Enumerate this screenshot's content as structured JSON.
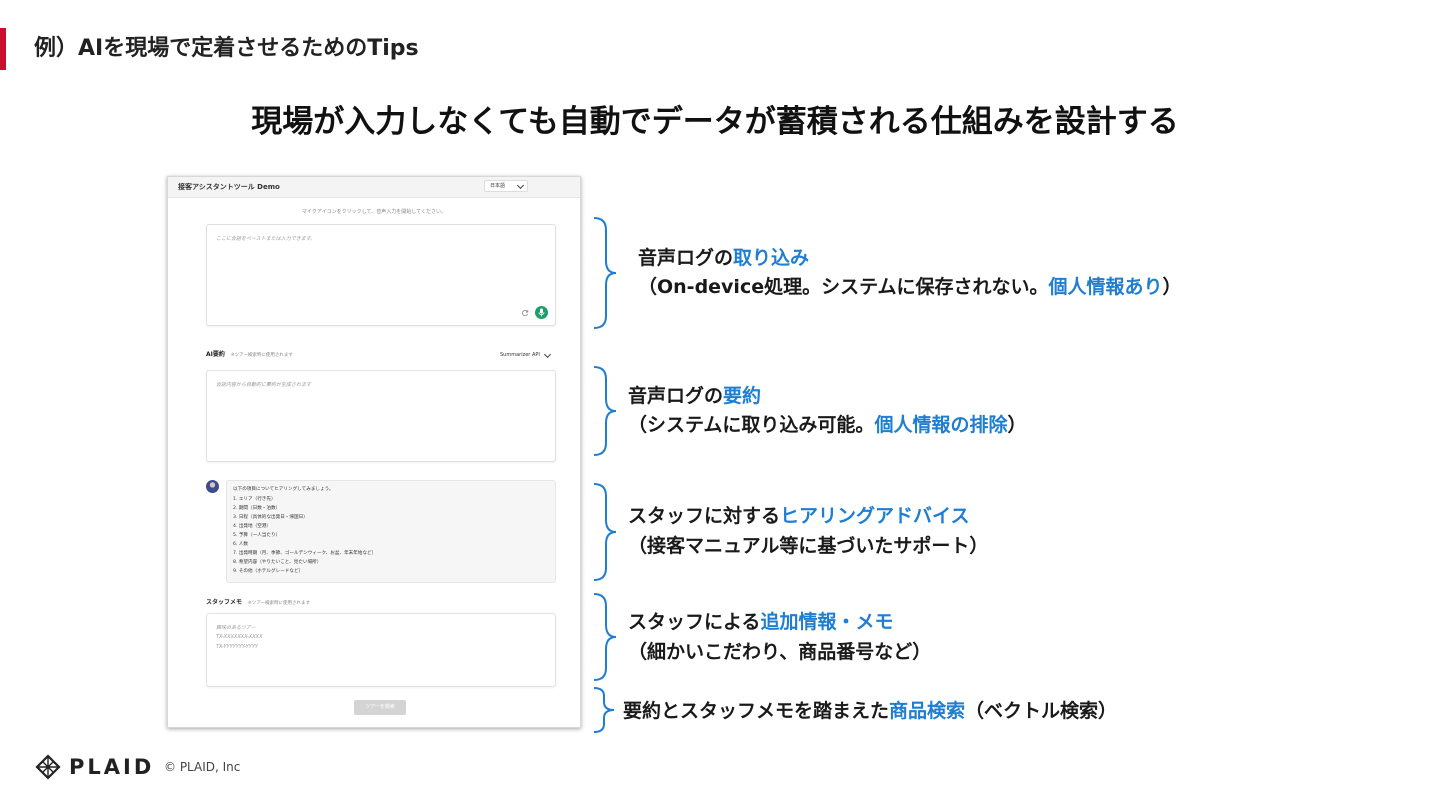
{
  "theme": {
    "accent": "#c8102e",
    "highlight": "#1f7ed1",
    "mic_green": "#1f9d6b"
  },
  "slide": {
    "label": "例）AIを現場で定着させるためのTips",
    "headline": "現場が入力しなくても自動でデータが蓄積される仕組みを設計する"
  },
  "app": {
    "title": "接客アシスタントツール Demo",
    "language": "日本語",
    "mic_hint": "マイクアイコンをクリックして、音声入力を開始してください。",
    "input_placeholder": "ここに会話をペーストまたは入力できます。",
    "refresh_icon": "refresh-icon",
    "mic_icon": "mic-icon",
    "summary": {
      "label": "AI要約",
      "note": "※ツアー検索時に使用されます",
      "api": "Summarizer API",
      "placeholder": "会話内容から自動的に要約が生成されます"
    },
    "chat": {
      "intro": "以下の項目についてヒアリングしてみましょう。",
      "items": [
        "1. エリア（行き先）",
        "2. 期間（日数・泊数）",
        "3. 日程（具体的な出発日・帰国日）",
        "4. 出発地（空港）",
        "5. 予算（一人当たり）",
        "6. 人数",
        "7. 出発時期（月、季節、ゴールデンウィーク、お盆、年末年始など）",
        "8. 希望内容（やりたいこと、見たい場所）",
        "9. その他（ホテルグレードなど）"
      ]
    },
    "memo": {
      "label": "スタッフメモ",
      "note": "※ツアー検索時に使用されます",
      "lines": [
        "興味のあるツアー",
        "TX-XXXXXXX-XXXX",
        "TX-YYYYYYY-YYYY"
      ]
    },
    "search_button": "ツアーを検索"
  },
  "annotations": [
    {
      "line1_pre": "音声ログの",
      "line1_hl": "取り込み",
      "line2_pre": "（On-device処理。システムに保存されない。",
      "line2_hl": "個人情報あり",
      "line2_post": "）"
    },
    {
      "line1_pre": "音声ログの",
      "line1_hl": "要約",
      "line2_pre": "（システムに取り込み可能。",
      "line2_hl": "個人情報の排除",
      "line2_post": "）"
    },
    {
      "line1_pre": "スタッフに対する",
      "line1_hl": "ヒアリングアドバイス",
      "line2_pre": "（接客マニュアル等に基づいたサポート）",
      "line2_hl": "",
      "line2_post": ""
    },
    {
      "line1_pre": "スタッフによる",
      "line1_hl": "追加情報・メモ",
      "line2_pre": "（細かいこだわり、商品番号など）",
      "line2_hl": "",
      "line2_post": ""
    },
    {
      "line1_pre": "要約とスタッフメモを踏まえた",
      "line1_hl": "商品検索",
      "line1_post": "（ベクトル検索）"
    }
  ],
  "footer": {
    "logo": "PLAID",
    "copyright": "© PLAID, Inc"
  }
}
